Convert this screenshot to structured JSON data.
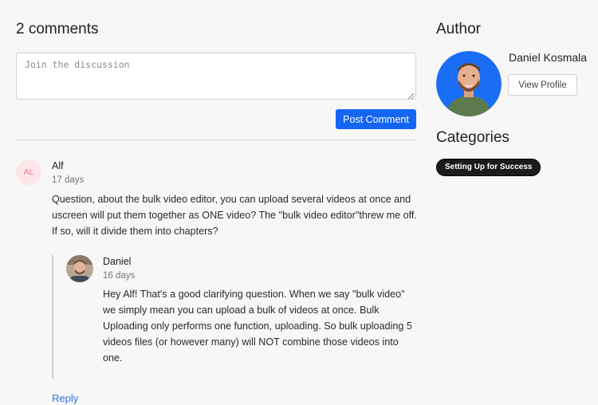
{
  "comments": {
    "title": "2 comments",
    "placeholder": "Join the discussion",
    "post_label": "Post Comment",
    "items": [
      {
        "initials": "AL",
        "author": "Alf",
        "time": "17 days",
        "text": "Question, about the bulk video editor, you can upload several videos at once and uscreen will put them together as ONE video? The \"bulk video editor\"threw me off. If so, will it divide them into chapters?",
        "replies": [
          {
            "author": "Daniel",
            "time": "16 days",
            "text": "Hey Alf! That's a good clarifying question. When we say \"bulk video\" we simply mean you can upload a bulk of videos at once. Bulk Uploading only performs one function, uploading. So bulk uploading 5 videos files (or however many) will NOT combine those videos into one."
          }
        ],
        "reply_label": "Reply"
      }
    ]
  },
  "sidebar": {
    "author_title": "Author",
    "author_name": "Daniel Kosmala",
    "view_profile_label": "View Profile",
    "categories_title": "Categories",
    "categories": [
      "Setting Up for Success"
    ]
  },
  "colors": {
    "accent": "#1565f3",
    "link": "#2f6fe0",
    "initials_bg": "#fde5ea",
    "initials_fg": "#e87a93",
    "avatar_ring": "#1a6ef5",
    "tag_bg": "#1b1b1b"
  }
}
